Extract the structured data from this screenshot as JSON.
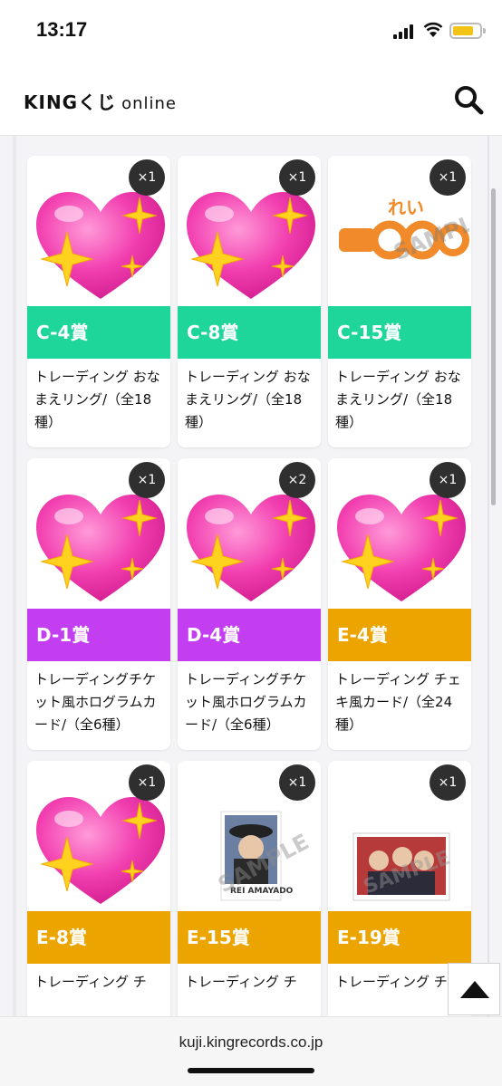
{
  "status": {
    "time": "13:17"
  },
  "header": {
    "logo_main": "KINGくじ",
    "logo_sub": "ONLINE"
  },
  "colors": {
    "c_band": "#1ed69a",
    "d_band": "#c23ef0",
    "e_band": "#eba400"
  },
  "cards": [
    {
      "qty": "×1",
      "prize": "C-4賞",
      "desc": "トレーディング おなまえリング/（全18種）",
      "band": "c",
      "image": "heart-emoji"
    },
    {
      "qty": "×1",
      "prize": "C-8賞",
      "desc": "トレーディング おなまえリング/（全18種）",
      "band": "c",
      "image": "heart-emoji"
    },
    {
      "qty": "×1",
      "prize": "C-15賞",
      "desc": "トレーディング おなまえリング/（全18種）",
      "band": "c",
      "image": "name-ring-sample"
    },
    {
      "qty": "×1",
      "prize": "D-1賞",
      "desc": "トレーディングチケット風ホログラムカード/（全6種）",
      "band": "d",
      "image": "heart-emoji"
    },
    {
      "qty": "×2",
      "prize": "D-4賞",
      "desc": "トレーディングチケット風ホログラムカード/（全6種）",
      "band": "d",
      "image": "heart-emoji"
    },
    {
      "qty": "×1",
      "prize": "E-4賞",
      "desc": "トレーディング チェキ風カード/（全24種）",
      "band": "e",
      "image": "heart-emoji"
    },
    {
      "qty": "×1",
      "prize": "E-8賞",
      "desc": "トレーディング チ",
      "band": "e",
      "image": "heart-emoji"
    },
    {
      "qty": "×1",
      "prize": "E-15賞",
      "desc": "トレーディング チ",
      "band": "e",
      "image": "character-card-sample"
    },
    {
      "qty": "×1",
      "prize": "E-19賞",
      "desc": "トレーディング チ",
      "band": "e",
      "image": "group-card-sample"
    }
  ],
  "footer": {
    "url": "kuji.kingrecords.co.jp"
  },
  "icons": {
    "search": "search-icon",
    "scroll_top": "arrow-up-icon"
  }
}
